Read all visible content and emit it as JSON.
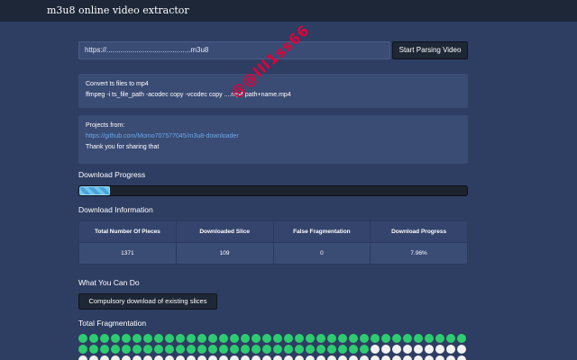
{
  "header": {
    "title": "m3u8 online video extractor"
  },
  "url_bar": {
    "value": "https://..........................................m3u8",
    "button_label": "Start Parsing Video"
  },
  "convert_panel": {
    "line1": "Convert ts files to mp4",
    "line2": "ffmpeg -i ts_file_path -acodec copy -vcodec copy ....mp4 path+name.mp4"
  },
  "projects_panel": {
    "line1": "Projects from:",
    "link": "https://github.com/Momo707577045/m3u8-downloader",
    "line3": "Thank you for sharing that"
  },
  "progress": {
    "heading": "Download Progress",
    "percent": 7.96
  },
  "info": {
    "heading": "Download Information",
    "columns": [
      "Total Number Of Pieces",
      "Downloaded Slice",
      "False Fragmentation",
      "Download Progress"
    ],
    "values": [
      "1371",
      "109",
      "0",
      "7.96%"
    ]
  },
  "actions": {
    "heading": "What You Can Do",
    "button_label": "Compulsory download of existing slices"
  },
  "fragmentation": {
    "heading": "Total Fragmentation",
    "downloaded": 109,
    "total": 1371,
    "colors": {
      "done": "#2ecc71",
      "pending": "#f2f2f2"
    }
  },
  "watermark": {
    "text": "@@lll1ss66"
  },
  "theme": {
    "background": "#2e3d62",
    "panel": "#3a4b74",
    "link": "#6aaae8",
    "progress": "#6cc4ee"
  }
}
